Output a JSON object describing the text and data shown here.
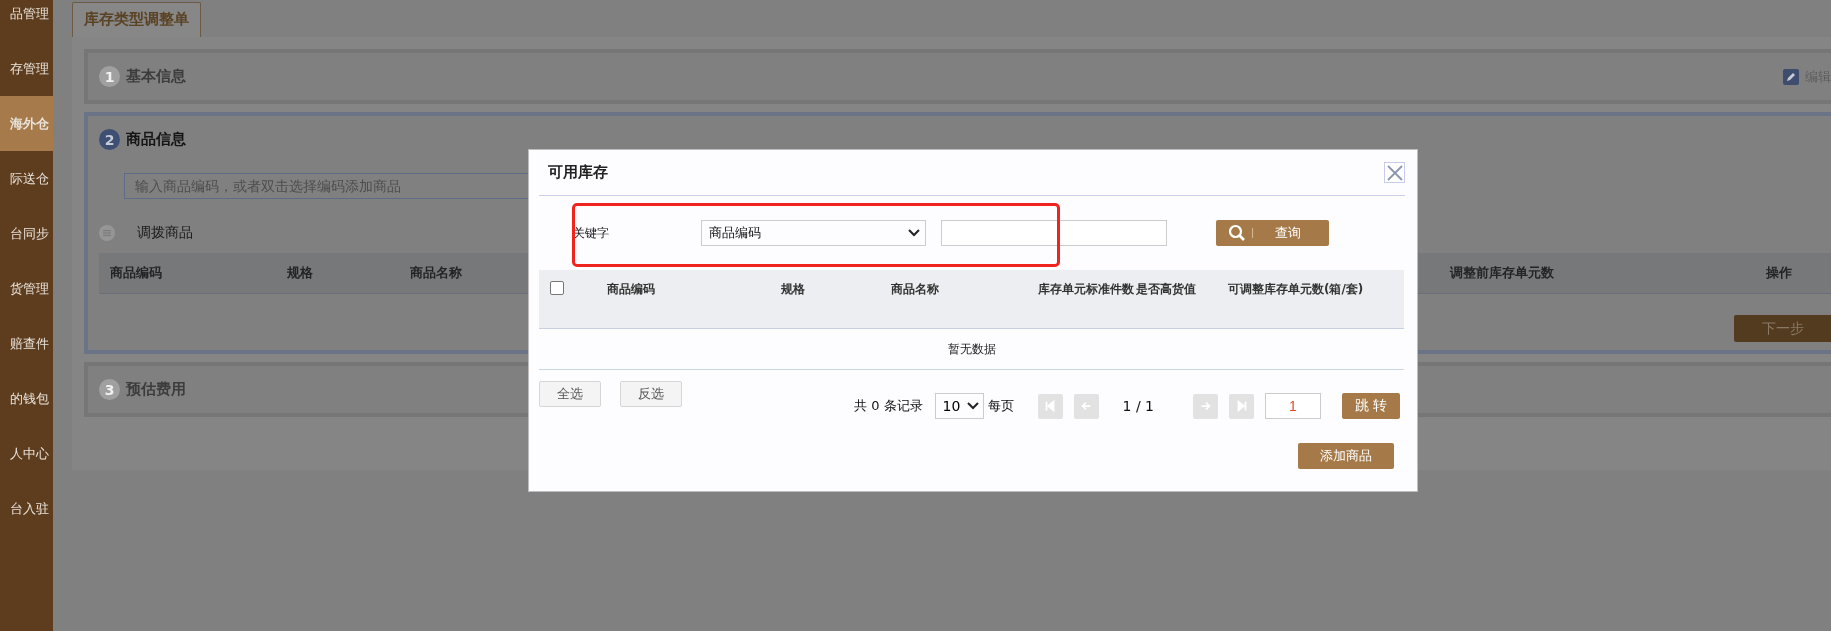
{
  "sidebar": {
    "items": [
      {
        "label": "品管理",
        "selected": false
      },
      {
        "label": "存管理",
        "selected": false
      },
      {
        "label": "海外仓",
        "selected": true
      },
      {
        "label": "际送仓",
        "selected": false
      },
      {
        "label": "台同步",
        "selected": false
      },
      {
        "label": "货管理",
        "selected": false
      },
      {
        "label": "赔查件",
        "selected": false
      },
      {
        "label": "的钱包",
        "selected": false
      },
      {
        "label": "人中心",
        "selected": false
      },
      {
        "label": "台入驻",
        "selected": false
      }
    ]
  },
  "tabs": [
    {
      "label": "库存类型调整单",
      "selected": true
    }
  ],
  "sections": [
    {
      "number": "1",
      "title": "基本信息",
      "active": false,
      "edit_label": "编辑"
    },
    {
      "number": "2",
      "title": "商品信息",
      "active": true,
      "search": {
        "placeholder": "输入商品编码，或者双击选择编码添加商品"
      },
      "subheading": "调拨商品",
      "table": {
        "columns": [
          "商品编码",
          "规格",
          "商品名称",
          "调整前库存单元数",
          "操作"
        ]
      },
      "next_button": "下一步"
    },
    {
      "number": "3",
      "title": "预估费用",
      "active": false
    }
  ],
  "dialog": {
    "title": "可用库存",
    "filter": {
      "label": "关键字",
      "field_select": "商品编码",
      "query_button": "查询",
      "highlighted": true
    },
    "table": {
      "select_all_checked": false,
      "columns": [
        "商品编码",
        "规格",
        "商品名称",
        "库存单元标准件数",
        "是否高货值",
        "可调整库存单元数(箱/套)"
      ],
      "empty_text": "暂无数据"
    },
    "select_all_button": "全选",
    "invert_button": "反选",
    "pagination": {
      "total": "共 0 条记录",
      "page_size": "10",
      "page_size_suffix": "每页",
      "nav_disabled": true,
      "page_info": "1 / 1",
      "page_input": "1",
      "jump_button": "跳 转"
    },
    "add_button": "添加商品"
  }
}
